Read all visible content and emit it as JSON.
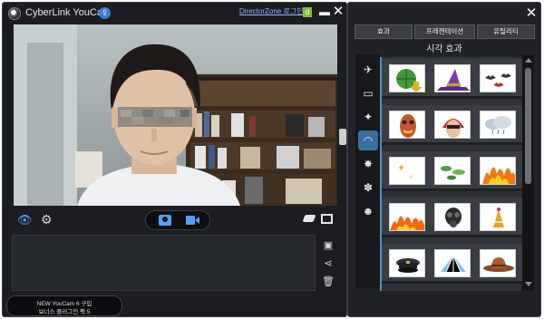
{
  "main_window": {
    "title": "CyberLink YouCam",
    "directorzone_link": "DirectorZone 로그인",
    "bonus_line1": "NEW YouCam 6 구입",
    "bonus_line2": "보너스 플러그인 팩 5"
  },
  "effects_window": {
    "tabs": [
      "효과",
      "프레젠테이션",
      "유틸리티"
    ],
    "section_title": "시각 효과",
    "categories": [
      "frame-icon",
      "scene-icon",
      "particle-icon",
      "mask-icon",
      "emotion-icon",
      "distortion-icon",
      "face-icon"
    ],
    "effects": [
      [
        "globe-download",
        "witch-hat",
        "bats"
      ],
      [
        "tribal-mask",
        "red-headdress",
        "storm-cloud"
      ],
      [
        "sparkles",
        "leaves",
        "flames"
      ],
      [
        "fire-wall",
        "gas-mask",
        "party-hat"
      ],
      [
        "police-cap",
        "crystal-hat",
        "cowboy-hat"
      ]
    ]
  },
  "colors": {
    "accent": "#4ea2ff",
    "window_bg": "#1b1d20"
  }
}
